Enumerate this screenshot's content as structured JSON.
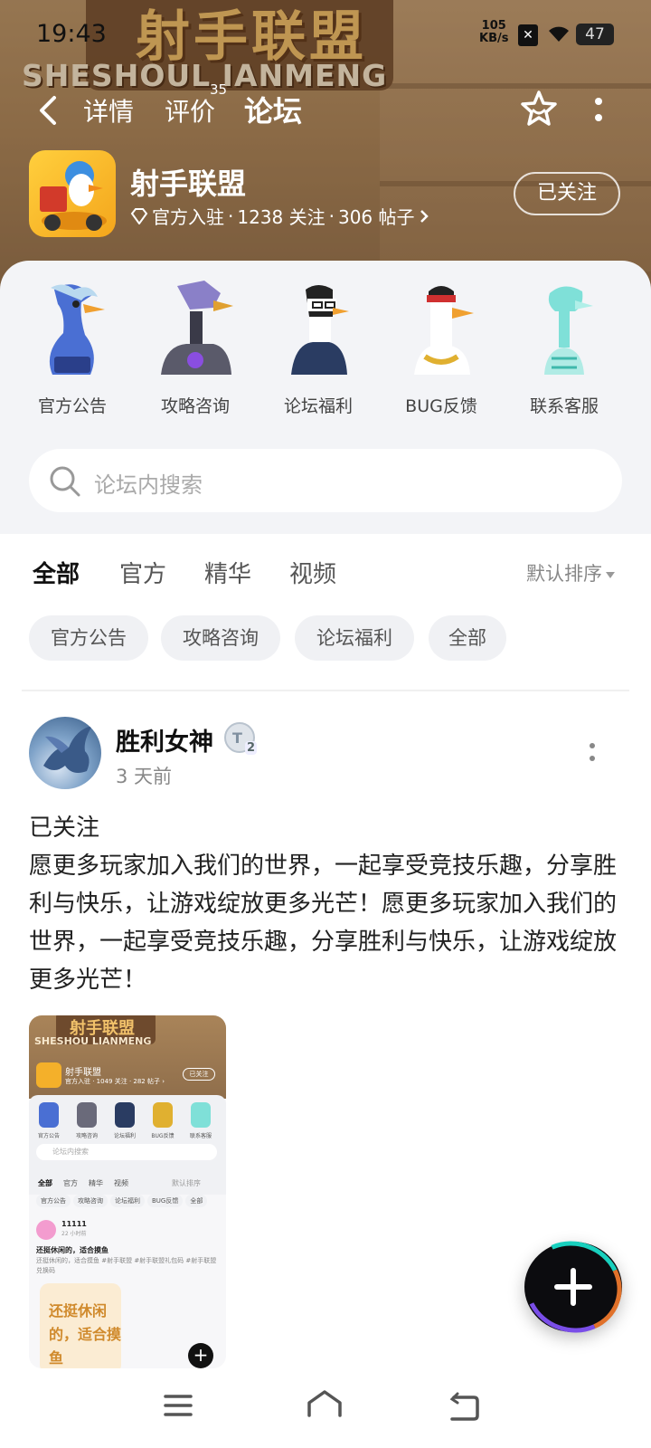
{
  "status_bar": {
    "time": "19:43",
    "speed_value": "105",
    "speed_unit": "KB/s",
    "battery": "47"
  },
  "banner": {
    "sign_cn": "射手联盟",
    "sign_en": "SHESHOUL IANMENG"
  },
  "nav": {
    "tabs": [
      {
        "label": "详情"
      },
      {
        "label": "评价",
        "badge": "35"
      },
      {
        "label": "论坛"
      }
    ],
    "active_tab": "论坛"
  },
  "game": {
    "name": "射手联盟",
    "official": "官方入驻",
    "follows": "1238 关注",
    "posts": "306 帖子",
    "separator": "·",
    "follow_button": "已关注"
  },
  "categories": [
    {
      "label": "官方公告",
      "icon": "blue-goose-icon"
    },
    {
      "label": "攻略咨询",
      "icon": "robot-goose-icon"
    },
    {
      "label": "论坛福利",
      "icon": "suit-goose-icon"
    },
    {
      "label": "BUG反馈",
      "icon": "bandana-goose-icon"
    },
    {
      "label": "联系客服",
      "icon": "ghost-goose-icon"
    }
  ],
  "search": {
    "placeholder": "论坛内搜索"
  },
  "filter_tabs": [
    "全部",
    "官方",
    "精华",
    "视频"
  ],
  "sort": "默认排序",
  "chips": [
    "官方公告",
    "攻略咨询",
    "论坛福利",
    "全部"
  ],
  "post": {
    "author": "胜利女神",
    "level": "2",
    "time": "3 天前",
    "status": "已关注",
    "body": "愿更多玩家加入我们的世界，一起享受竞技乐趣，分享胜利与快乐，让游戏绽放更多光芒！愿更多玩家加入我们的世界，一起享受竞技乐趣，分享胜利与快乐，让游戏绽放更多光芒！"
  },
  "thumbnail": {
    "sign": "射手联盟",
    "sign_en": "SHESHOU LIANMENG",
    "game_name": "射手联盟",
    "game_meta": "官方入驻 · 1049 关注 · 282 帖子 ›",
    "follow": "已关注",
    "categories": [
      "官方公告",
      "攻略咨询",
      "论坛福利",
      "BUG反馈",
      "联系客服"
    ],
    "search": "论坛内搜索",
    "tabs": [
      "全部",
      "官方",
      "精华",
      "视频"
    ],
    "sort": "默认排序",
    "chips": [
      "官方公告",
      "攻略咨询",
      "论坛福利",
      "BUG反馈",
      "全部"
    ],
    "user": "11111",
    "user_time": "22 小时前",
    "title": "还挺休闲的，适合摸鱼",
    "content": "还挺休闲的，适合摸鱼 #射手联盟 #射手联盟礼包码 #射手联盟兑换码",
    "card": "还挺休闲的，适合摸鱼"
  },
  "colors": {
    "accent": "#2ee0c3",
    "banner": "#a98459",
    "panel": "#f3f4f7"
  }
}
